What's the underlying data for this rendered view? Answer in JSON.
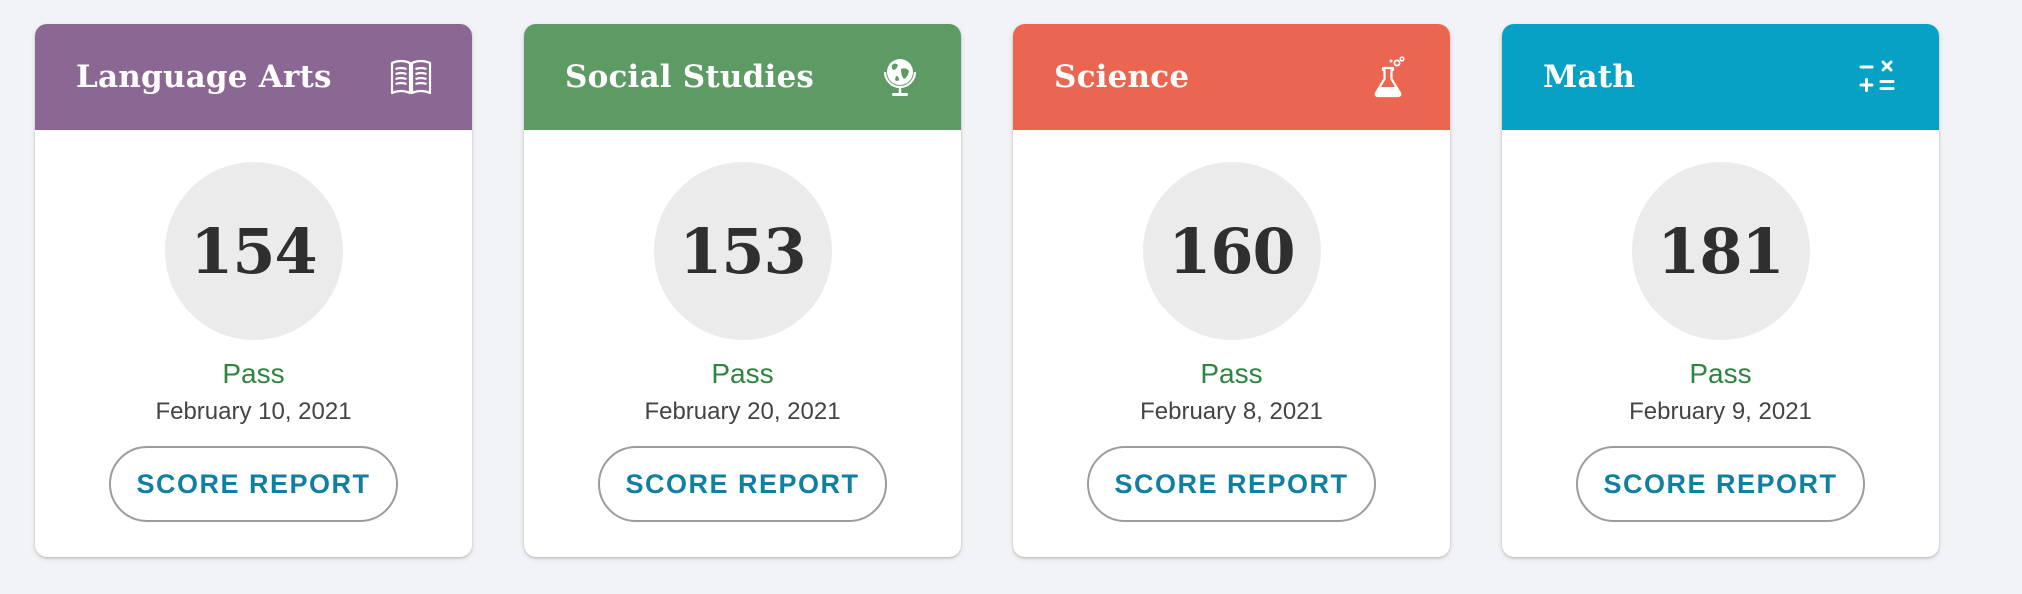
{
  "cards": [
    {
      "subject": "Language Arts",
      "icon": "open-book-icon",
      "header_color": "#8b6794",
      "score": "154",
      "status": "Pass",
      "date": "February 10, 2021",
      "button_label": "SCORE REPORT"
    },
    {
      "subject": "Social Studies",
      "icon": "globe-icon",
      "header_color": "#5e9a63",
      "score": "153",
      "status": "Pass",
      "date": "February 20, 2021",
      "button_label": "SCORE REPORT"
    },
    {
      "subject": "Science",
      "icon": "flask-icon",
      "header_color": "#ea6650",
      "score": "160",
      "status": "Pass",
      "date": "February 8, 2021",
      "button_label": "SCORE REPORT"
    },
    {
      "subject": "Math",
      "icon": "math-operators-icon",
      "header_color": "#06a1c4",
      "score": "181",
      "status": "Pass",
      "date": "February 9, 2021",
      "button_label": "SCORE REPORT"
    }
  ],
  "colors": {
    "pass": "#2e8540",
    "button_text": "#117fa3",
    "page_background": "#f2f3f6"
  }
}
